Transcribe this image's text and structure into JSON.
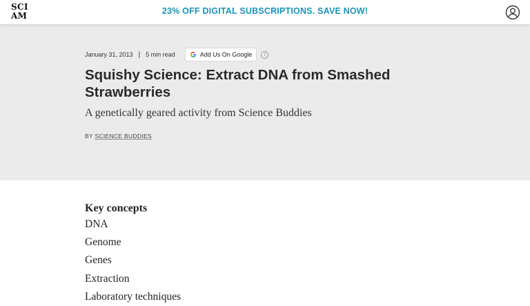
{
  "header": {
    "logo_line1": "SCI",
    "logo_line2": "AM",
    "promo_text": "23% OFF DIGITAL SUBSCRIPTIONS. SAVE NOW!",
    "account_icon": "user-circle-icon",
    "promo_color": "#1a93b6"
  },
  "article": {
    "date": "January 31, 2013",
    "read_time": "5 min read",
    "google_button_label": "Add Us On Google",
    "info_glyph": "i",
    "title": "Squishy Science: Extract DNA from Smashed Strawberries",
    "subtitle": "A genetically geared activity from Science Buddies",
    "byline_prefix": "BY",
    "author": "SCIENCE BUDDIES",
    "hero_background": "#ebebeb"
  },
  "key_concepts": {
    "heading": "Key concepts",
    "items": [
      "DNA",
      "Genome",
      "Genes",
      "Extraction",
      "Laboratory techniques"
    ]
  }
}
